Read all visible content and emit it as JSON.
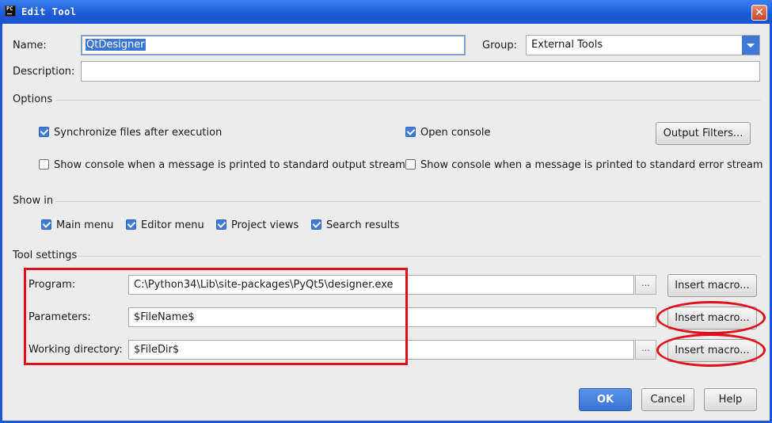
{
  "window": {
    "title": "Edit Tool",
    "icon_text": "PC",
    "close_glyph": "✕"
  },
  "form": {
    "name_label": "Name:",
    "name_value": "QtDesigner",
    "group_label": "Group:",
    "group_value": "External Tools",
    "description_label": "Description:",
    "description_value": ""
  },
  "options": {
    "title": "Options",
    "sync_files": {
      "label": "Synchronize files after execution",
      "checked": true
    },
    "open_console": {
      "label": "Open console",
      "checked": true
    },
    "output_filters_button": "Output Filters...",
    "show_console_stdout": {
      "label": "Show console when a message is printed to standard output stream",
      "checked": false
    },
    "show_console_stderr": {
      "label": "Show console when a message is printed to standard error stream",
      "checked": false
    }
  },
  "show_in": {
    "title": "Show in",
    "items": [
      {
        "label": "Main menu",
        "checked": true
      },
      {
        "label": "Editor menu",
        "checked": true
      },
      {
        "label": "Project views",
        "checked": true
      },
      {
        "label": "Search results",
        "checked": true
      }
    ]
  },
  "tool_settings": {
    "title": "Tool settings",
    "program_label": "Program:",
    "program_value": "C:\\Python34\\Lib\\site-packages\\PyQt5\\designer.exe",
    "parameters_label": "Parameters:",
    "parameters_value": "$FileName$",
    "working_dir_label": "Working directory:",
    "working_dir_value": "$FileDir$",
    "browse_glyph": "...",
    "insert_macro_label": "Insert macro..."
  },
  "buttons": {
    "ok": "OK",
    "cancel": "Cancel",
    "help": "Help"
  },
  "colors": {
    "annotation": "#e0101a",
    "accent": "#3f7bd9",
    "titlebar": "#1b5ad8"
  }
}
